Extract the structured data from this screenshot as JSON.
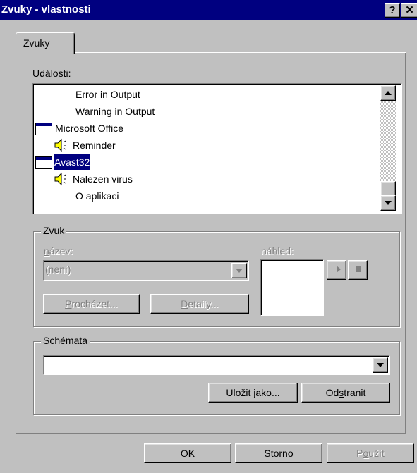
{
  "window": {
    "title": "Zvuky - vlastnosti",
    "help_label": "?",
    "close_label": "✕"
  },
  "tabs": [
    {
      "label": "Zvuky"
    }
  ],
  "events": {
    "label_u": "U",
    "label_rest": "dálosti:",
    "items": [
      {
        "label": "Error in Output",
        "icon": "none",
        "selected": false
      },
      {
        "label": "Warning in Output",
        "icon": "none",
        "selected": false
      },
      {
        "label": "Microsoft Office",
        "icon": "window-icon",
        "selected": false
      },
      {
        "label": "Reminder",
        "icon": "speaker-icon",
        "selected": false
      },
      {
        "label": "Avast32",
        "icon": "window-icon",
        "selected": true
      },
      {
        "label": "Nalezen virus",
        "icon": "speaker-icon",
        "selected": false
      },
      {
        "label": "O aplikaci",
        "icon": "none",
        "selected": false
      }
    ]
  },
  "sound_group": {
    "title": "Zvuk",
    "name_label_u": "n",
    "name_label_rest": "ázev:",
    "name_value": "(není)",
    "preview_label": "náhled:",
    "browse_u": "P",
    "browse_rest": "rocházet...",
    "details_u": "D",
    "details_rest": "etaily..."
  },
  "schemes_group": {
    "title_pre": "Sché",
    "title_u": "m",
    "title_post": "ata",
    "value": "",
    "save_pre": "Uložit ",
    "save_u": "j",
    "save_post": "ako...",
    "remove_pre": "Od",
    "remove_u": "s",
    "remove_post": "tranit"
  },
  "footer": {
    "ok_label": "OK",
    "cancel_label": "Storno",
    "apply_pre": "P",
    "apply_u": "o",
    "apply_post": "užít"
  },
  "colors": {
    "titlebar": "#000080",
    "face": "#c0c0c0",
    "selection": "#000080"
  }
}
